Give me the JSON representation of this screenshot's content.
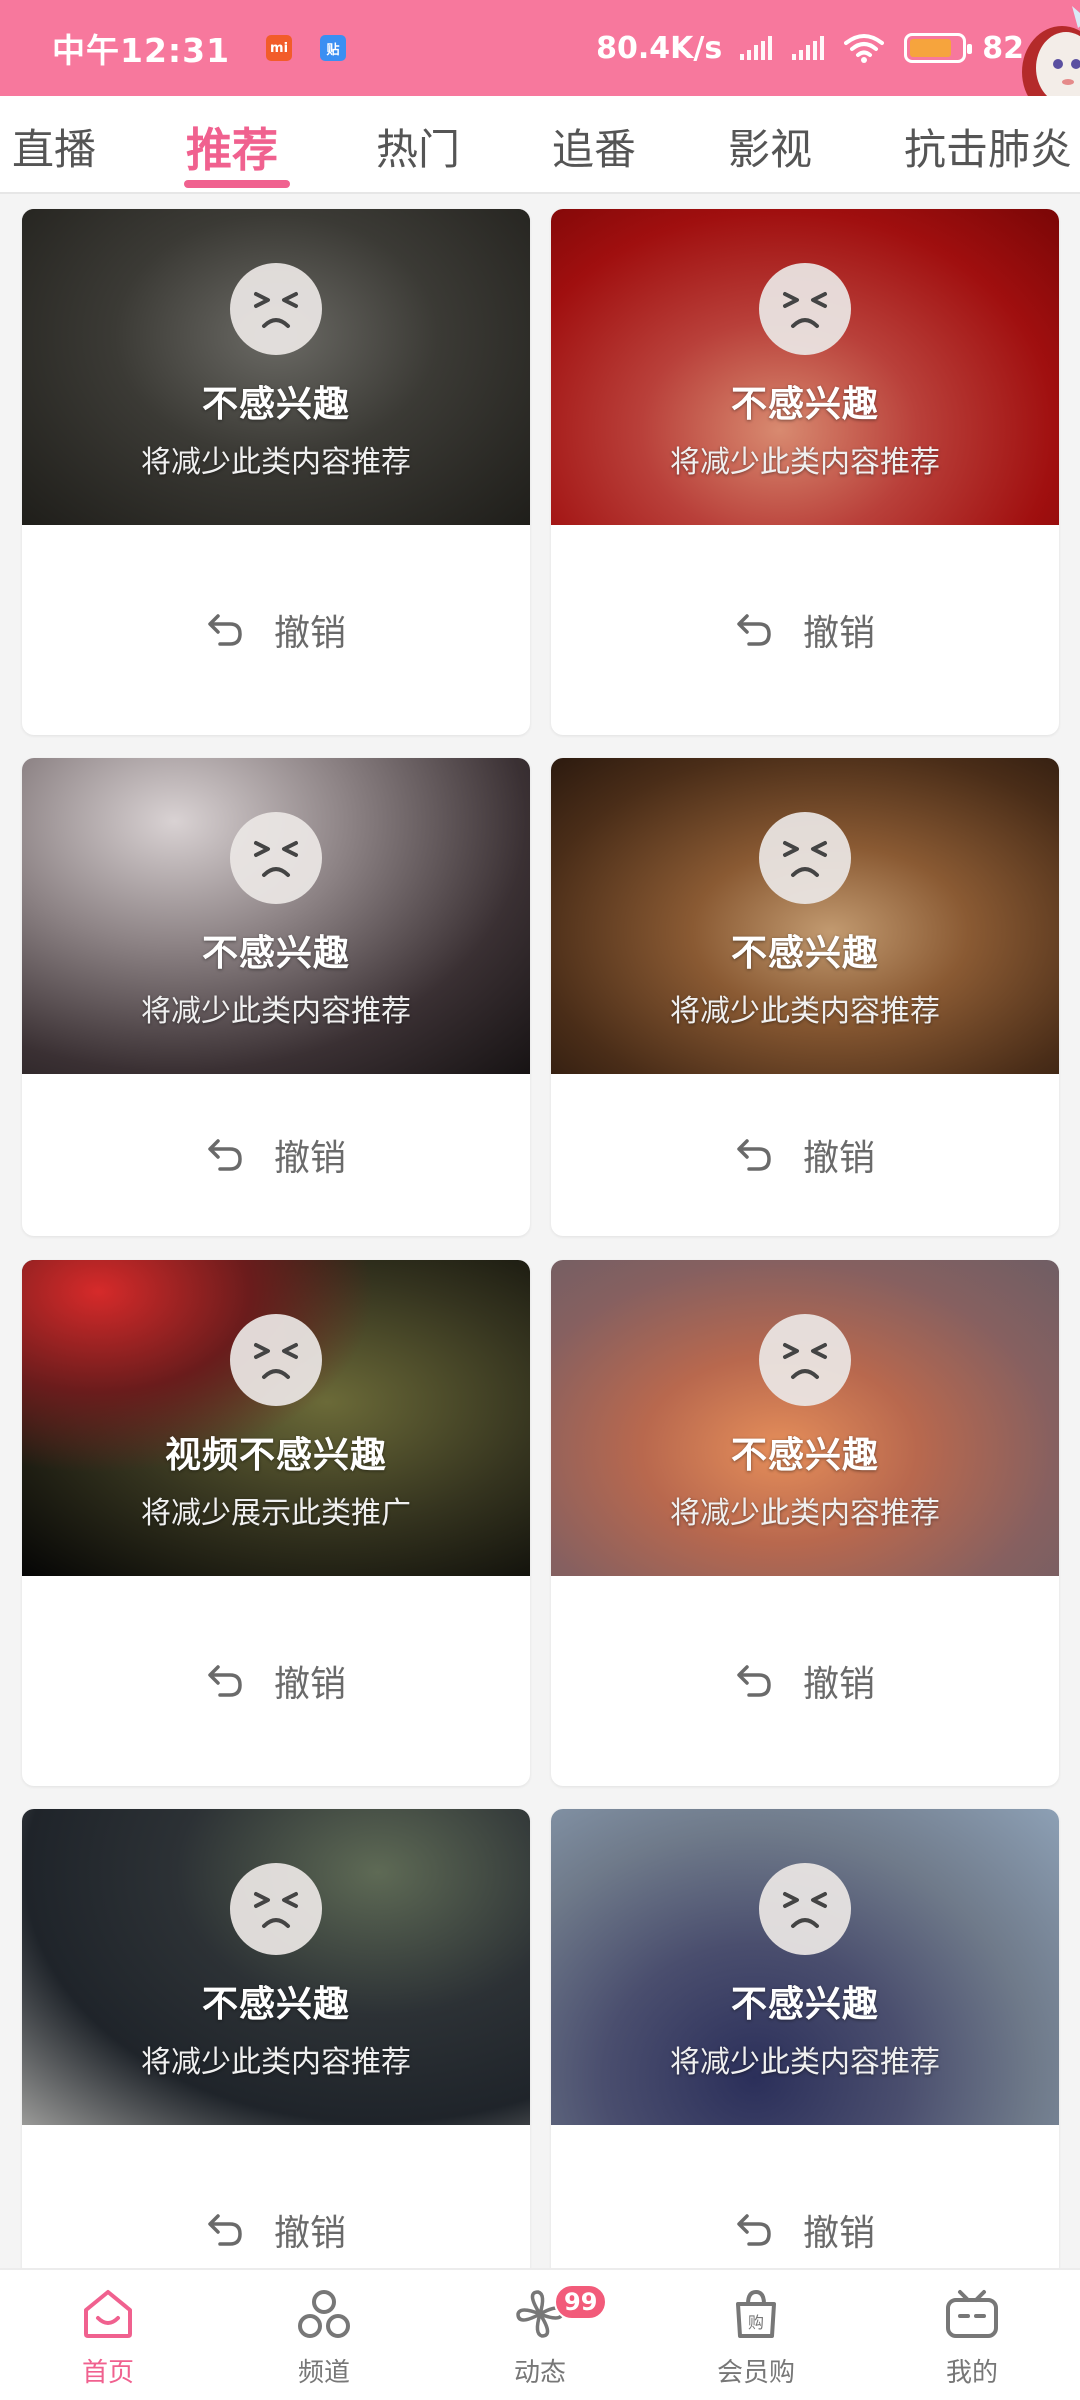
{
  "status_bar": {
    "time": "中午12:31",
    "notif_mi": "mi",
    "notif_tie": "贴",
    "net_speed": "80.4K/s",
    "battery_percent": "82",
    "battery_level": 0.82,
    "battery_color": "#f6a43d"
  },
  "tabs": [
    {
      "label": "直播"
    },
    {
      "label": "推荐",
      "active": true
    },
    {
      "label": "热门"
    },
    {
      "label": "追番"
    },
    {
      "label": "影视"
    },
    {
      "label": "抗击肺炎"
    }
  ],
  "cards": [
    {
      "title": "不感兴趣",
      "subtitle": "将减少此类内容推荐",
      "undo": "撤销"
    },
    {
      "title": "不感兴趣",
      "subtitle": "将减少此类内容推荐",
      "undo": "撤销"
    },
    {
      "title": "不感兴趣",
      "subtitle": "将减少此类内容推荐",
      "undo": "撤销"
    },
    {
      "title": "不感兴趣",
      "subtitle": "将减少此类内容推荐",
      "undo": "撤销"
    },
    {
      "title": "视频不感兴趣",
      "subtitle": "将减少展示此类推广",
      "undo": "撤销"
    },
    {
      "title": "不感兴趣",
      "subtitle": "将减少此类内容推荐",
      "undo": "撤销"
    },
    {
      "title": "不感兴趣",
      "subtitle": "将减少此类内容推荐",
      "undo": "撤销"
    },
    {
      "title": "不感兴趣",
      "subtitle": "将减少此类内容推荐",
      "undo": "撤销"
    }
  ],
  "bottom_nav": [
    {
      "label": "首页",
      "icon": "home-tv-icon",
      "active": true
    },
    {
      "label": "频道",
      "icon": "channel-icon"
    },
    {
      "label": "动态",
      "icon": "activity-icon",
      "badge": "99"
    },
    {
      "label": "会员购",
      "icon": "shopping-bag-icon"
    },
    {
      "label": "我的",
      "icon": "tv-mascot-icon"
    }
  ],
  "colors": {
    "accent": "#f0618f",
    "status_bar": "#f7789d",
    "badge": "#f25b7a"
  }
}
